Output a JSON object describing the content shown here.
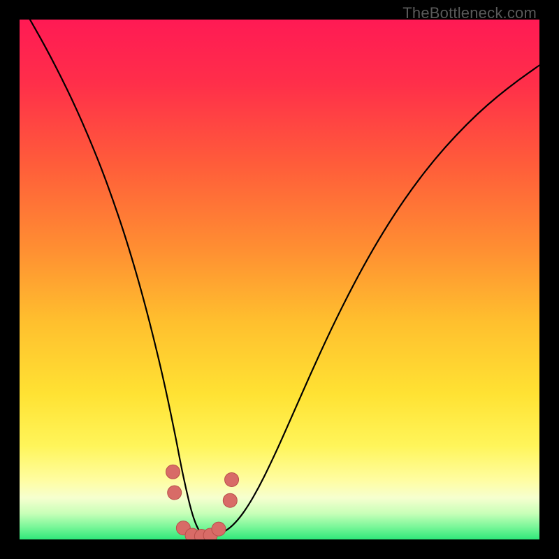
{
  "watermark": "TheBottleneck.com",
  "chart_data": {
    "type": "line",
    "title": "",
    "xlabel": "",
    "ylabel": "",
    "xlim": [
      0,
      100
    ],
    "ylim": [
      0,
      100
    ],
    "grid": false,
    "legend": false,
    "colors": {
      "gradient_stops": [
        {
          "offset": 0.0,
          "color": "#ff1a54"
        },
        {
          "offset": 0.12,
          "color": "#ff2e4a"
        },
        {
          "offset": 0.28,
          "color": "#ff5d3a"
        },
        {
          "offset": 0.44,
          "color": "#ff8e32"
        },
        {
          "offset": 0.58,
          "color": "#ffbf2e"
        },
        {
          "offset": 0.72,
          "color": "#ffe233"
        },
        {
          "offset": 0.82,
          "color": "#fff55a"
        },
        {
          "offset": 0.885,
          "color": "#fffda0"
        },
        {
          "offset": 0.92,
          "color": "#f6ffcf"
        },
        {
          "offset": 0.95,
          "color": "#c8ffb8"
        },
        {
          "offset": 0.975,
          "color": "#7cf79a"
        },
        {
          "offset": 1.0,
          "color": "#2fe87a"
        }
      ],
      "curve": "#000000",
      "marker_fill": "#d86b67",
      "marker_stroke": "#b84e4a"
    },
    "series": [
      {
        "name": "bottleneck-curve",
        "x": [
          2,
          4,
          6,
          8,
          10,
          12,
          14,
          16,
          18,
          20,
          22,
          24,
          26,
          28,
          30,
          31,
          32,
          33,
          34,
          35,
          36,
          38,
          40,
          42,
          44,
          46,
          48,
          50,
          52,
          56,
          60,
          64,
          68,
          72,
          76,
          80,
          84,
          88,
          92,
          96,
          100
        ],
        "y": [
          100,
          96.5,
          92.8,
          88.9,
          84.8,
          80.4,
          75.7,
          70.7,
          65.2,
          59.3,
          52.8,
          45.7,
          37.9,
          29.4,
          19.8,
          14.5,
          9.8,
          5.6,
          2.6,
          1.0,
          0.6,
          0.9,
          1.8,
          3.7,
          6.5,
          10.0,
          14.0,
          18.3,
          22.8,
          31.9,
          40.6,
          48.6,
          55.9,
          62.4,
          68.2,
          73.3,
          77.8,
          81.8,
          85.3,
          88.4,
          91.2
        ]
      }
    ],
    "markers": [
      {
        "x": 29.5,
        "y": 13.0
      },
      {
        "x": 29.8,
        "y": 9.0
      },
      {
        "x": 31.5,
        "y": 2.2
      },
      {
        "x": 33.2,
        "y": 0.8
      },
      {
        "x": 35.0,
        "y": 0.6
      },
      {
        "x": 36.7,
        "y": 0.8
      },
      {
        "x": 38.3,
        "y": 2.0
      },
      {
        "x": 40.5,
        "y": 7.5
      },
      {
        "x": 40.8,
        "y": 11.5
      }
    ]
  }
}
